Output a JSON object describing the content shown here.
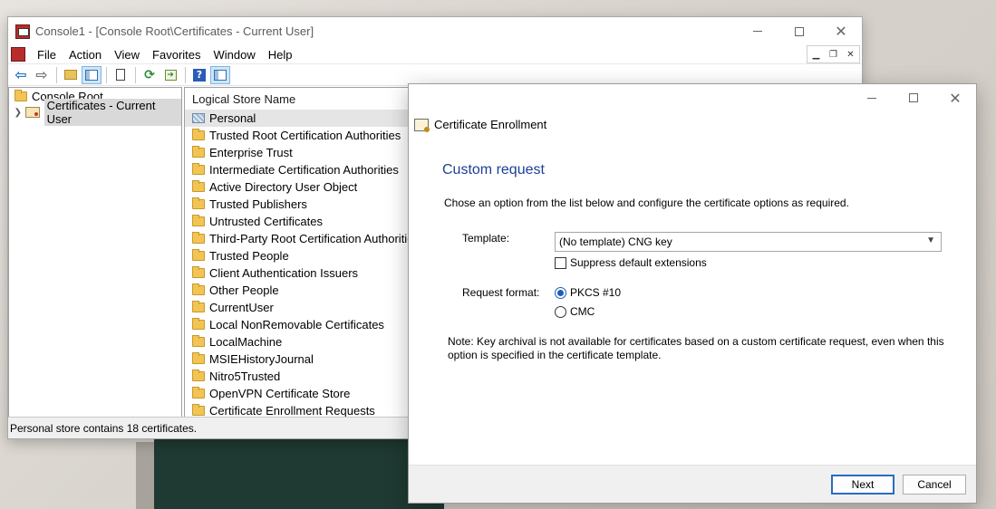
{
  "mmc": {
    "title": "Console1 - [Console Root\\Certificates - Current User]",
    "menu": [
      "File",
      "Action",
      "View",
      "Favorites",
      "Window",
      "Help"
    ],
    "tree": {
      "root": "Console Root",
      "child": "Certificates - Current User"
    },
    "list": {
      "header": "Logical Store Name",
      "items": [
        "Personal",
        "Trusted Root Certification Authorities",
        "Enterprise Trust",
        "Intermediate Certification Authorities",
        "Active Directory User Object",
        "Trusted Publishers",
        "Untrusted Certificates",
        "Third-Party Root Certification Authorities",
        "Trusted People",
        "Client Authentication Issuers",
        "Other People",
        "CurrentUser",
        "Local NonRemovable Certificates",
        "LocalMachine",
        "MSIEHistoryJournal",
        "Nitro5Trusted",
        "OpenVPN Certificate Store",
        "Certificate Enrollment Requests"
      ]
    },
    "status": "Personal store contains 18 certificates."
  },
  "dialog": {
    "title": "Certificate Enrollment",
    "heading": "Custom request",
    "instruction": "Chose an option from the list below and configure the certificate options as required.",
    "template_label": "Template:",
    "template_value": "(No template) CNG key",
    "suppress_label": "Suppress default extensions",
    "format_label": "Request format:",
    "format_options": [
      "PKCS #10",
      "CMC"
    ],
    "note": "Note: Key archival is not available for certificates based on a custom certificate request, even when this option is specified in the certificate template.",
    "next_label": "Next",
    "cancel_label": "Cancel"
  },
  "colors": {
    "heading": "#1c3f94",
    "accent": "#1a5fb4"
  }
}
